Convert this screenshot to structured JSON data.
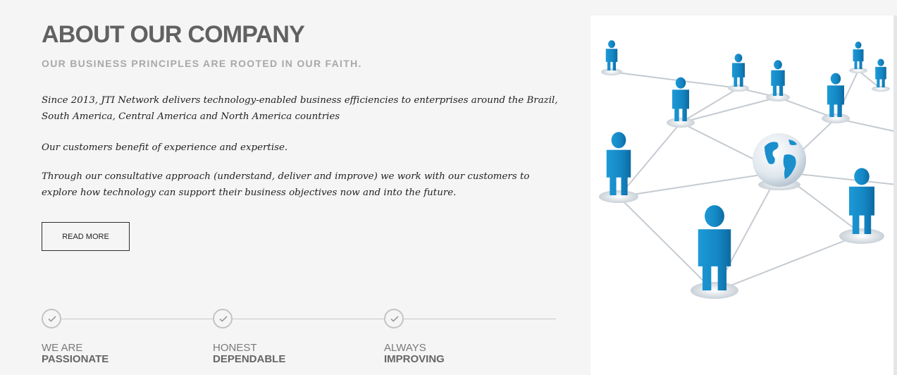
{
  "about": {
    "title": "ABOUT OUR COMPANY",
    "subtitle": "OUR BUSINESS PRINCIPLES ARE ROOTED IN OUR FAITH.",
    "paragraphs": [
      "Since 2013, JTI Network delivers technology-enabled business efficiencies to enterprises around the Brazil, South America, Central America and North America countries",
      "Our customers benefit of experience and expertise.",
      "Through our consultative approach (understand, deliver and improve) we work with our customers to explore how technology can support their business objectives now and into the future."
    ],
    "read_more_label": "READ MORE"
  },
  "principles": [
    {
      "line1": "WE ARE",
      "line2": "PASSIONATE",
      "icon": "check-circle-icon"
    },
    {
      "line1": "HONEST",
      "line2": "DEPENDABLE",
      "icon": "check-circle-icon"
    },
    {
      "line1": "ALWAYS",
      "line2": "IMPROVING",
      "icon": "check-circle-icon"
    }
  ],
  "image": {
    "icon": "network-people-globe-illustration"
  },
  "colors": {
    "title": "#616161",
    "subtitle": "#a8a8a8",
    "figure_blue": "#1a8fcc",
    "background": "#f5f5f5"
  }
}
